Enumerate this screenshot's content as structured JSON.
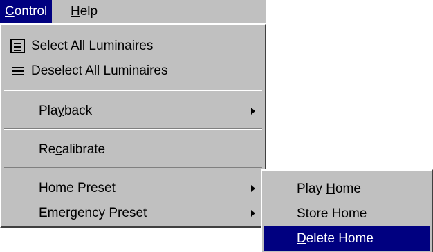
{
  "menubar": {
    "items": [
      {
        "pre": "",
        "u": "C",
        "post": "ontrol"
      },
      {
        "pre": "",
        "u": "H",
        "post": "elp"
      }
    ]
  },
  "control_menu": {
    "items": [
      {
        "pre": "Select All Luminaires",
        "u": "",
        "post": "",
        "icon": "select-all-icon"
      },
      {
        "pre": "Deselect All Luminaires",
        "u": "",
        "post": "",
        "icon": "deselect-all-icon"
      },
      {
        "pre": "Pla",
        "u": "y",
        "post": "back",
        "submenu": true
      },
      {
        "pre": "Re",
        "u": "c",
        "post": "alibrate"
      },
      {
        "pre": "Home Preset",
        "u": "",
        "post": "",
        "submenu": true
      },
      {
        "pre": "Emergency Preset",
        "u": "",
        "post": "",
        "submenu": true
      }
    ]
  },
  "home_submenu": {
    "items": [
      {
        "pre": "Play ",
        "u": "H",
        "post": "ome"
      },
      {
        "pre": "Store Home",
        "u": "",
        "post": ""
      },
      {
        "pre": "",
        "u": "D",
        "post": "elete Home",
        "highlighted": true
      }
    ]
  },
  "colors": {
    "menu_bg": "#c0c0c0",
    "highlight": "#000080"
  }
}
